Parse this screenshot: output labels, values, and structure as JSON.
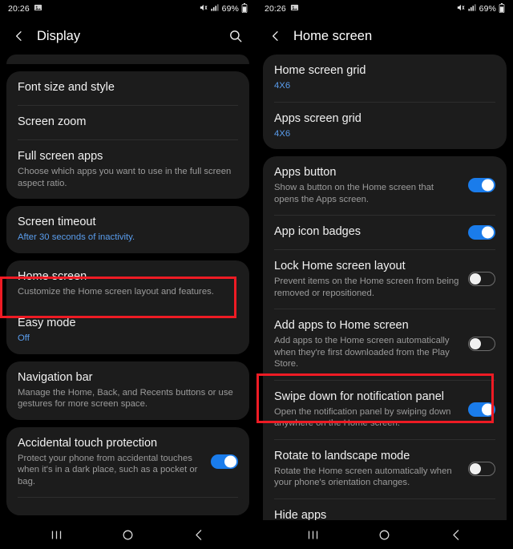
{
  "screens": [
    {
      "status_bar": {
        "time": "20:26",
        "icons_left": [
          "image-icon"
        ],
        "icons_right": [
          "mute-vibrate-icon",
          "signal-bars-icon"
        ],
        "battery_percent": "69%",
        "battery_icon": "battery-icon"
      },
      "app_bar": {
        "back_icon": "back-chevron-icon",
        "title": "Display",
        "search_icon": "search-icon"
      },
      "groups": [
        {
          "id": "clipped-top-card",
          "clipped": true,
          "rows": []
        },
        {
          "id": "display-basics",
          "rows": [
            {
              "title": "Font size and style",
              "sub": "",
              "sub_accent": false,
              "toggle": null
            },
            {
              "title": "Screen zoom",
              "sub": "",
              "sub_accent": false,
              "toggle": null
            },
            {
              "title": "Full screen apps",
              "sub": "Choose which apps you want to use in the full screen aspect ratio.",
              "sub_accent": false,
              "toggle": null
            }
          ]
        },
        {
          "id": "screen-timeout",
          "rows": [
            {
              "title": "Screen timeout",
              "sub": "After 30 seconds of inactivity.",
              "sub_accent": true,
              "toggle": null
            }
          ]
        },
        {
          "id": "home-easy",
          "rows": [
            {
              "title": "Home screen",
              "sub": "Customize the Home screen layout and features.",
              "sub_accent": false,
              "toggle": null,
              "highlighted": true
            },
            {
              "title": "Easy mode",
              "sub": "Off",
              "sub_accent": true,
              "toggle": null
            }
          ]
        },
        {
          "id": "navigation-bar",
          "rows": [
            {
              "title": "Navigation bar",
              "sub": "Manage the Home, Back, and Recents buttons or use gestures for more screen space.",
              "sub_accent": false,
              "toggle": null
            }
          ]
        },
        {
          "id": "accidental-touch",
          "clipped_bottom": true,
          "rows": [
            {
              "title": "Accidental touch protection",
              "sub": "Protect your phone from accidental touches when it's in a dark place, such as a pocket or bag.",
              "sub_accent": false,
              "toggle": "on"
            }
          ]
        }
      ],
      "nav_bar": {
        "recents_icon": "recents-icon",
        "home_icon": "home-icon",
        "back_icon": "back-icon"
      }
    },
    {
      "status_bar": {
        "time": "20:26",
        "icons_left": [
          "image-icon"
        ],
        "icons_right": [
          "mute-vibrate-icon",
          "signal-bars-icon"
        ],
        "battery_percent": "69%",
        "battery_icon": "battery-icon"
      },
      "app_bar": {
        "back_icon": "back-chevron-icon",
        "title": "Home screen",
        "search_icon": null
      },
      "groups": [
        {
          "id": "grids",
          "rows": [
            {
              "title": "Home screen grid",
              "sub": "4X6",
              "sub_accent": true,
              "toggle": null
            },
            {
              "title": "Apps screen grid",
              "sub": "4X6",
              "sub_accent": true,
              "toggle": null
            }
          ]
        },
        {
          "id": "home-options",
          "rows": [
            {
              "title": "Apps button",
              "sub": "Show a button on the Home screen that opens the Apps screen.",
              "sub_accent": false,
              "toggle": "on"
            },
            {
              "title": "App icon badges",
              "sub": "",
              "sub_accent": false,
              "toggle": "on"
            },
            {
              "title": "Lock Home screen layout",
              "sub": "Prevent items on the Home screen from being removed or repositioned.",
              "sub_accent": false,
              "toggle": "off"
            },
            {
              "title": "Add apps to Home screen",
              "sub": "Add apps to the Home screen automatically when they're first downloaded from the Play Store.",
              "sub_accent": false,
              "toggle": "off"
            },
            {
              "title": "Swipe down for notification panel",
              "sub": "Open the notification panel by swiping down anywhere on the Home screen.",
              "sub_accent": false,
              "toggle": "on",
              "highlighted": true
            },
            {
              "title": "Rotate to landscape mode",
              "sub": "Rotate the Home screen automatically when your phone's orientation changes.",
              "sub_accent": false,
              "toggle": "off"
            },
            {
              "title": "Hide apps",
              "sub": "",
              "sub_accent": false,
              "toggle": null
            }
          ]
        }
      ],
      "nav_bar": {
        "recents_icon": "recents-icon",
        "home_icon": "home-icon",
        "back_icon": "back-icon"
      }
    }
  ],
  "colors": {
    "background": "#000000",
    "card": "#1c1c1c",
    "accent_blue": "#5a9ded",
    "toggle_on": "#1a7ceb",
    "highlight_red": "#ee1b24",
    "title_text": "#f1f1f1",
    "sub_text": "#9b9b9b"
  }
}
